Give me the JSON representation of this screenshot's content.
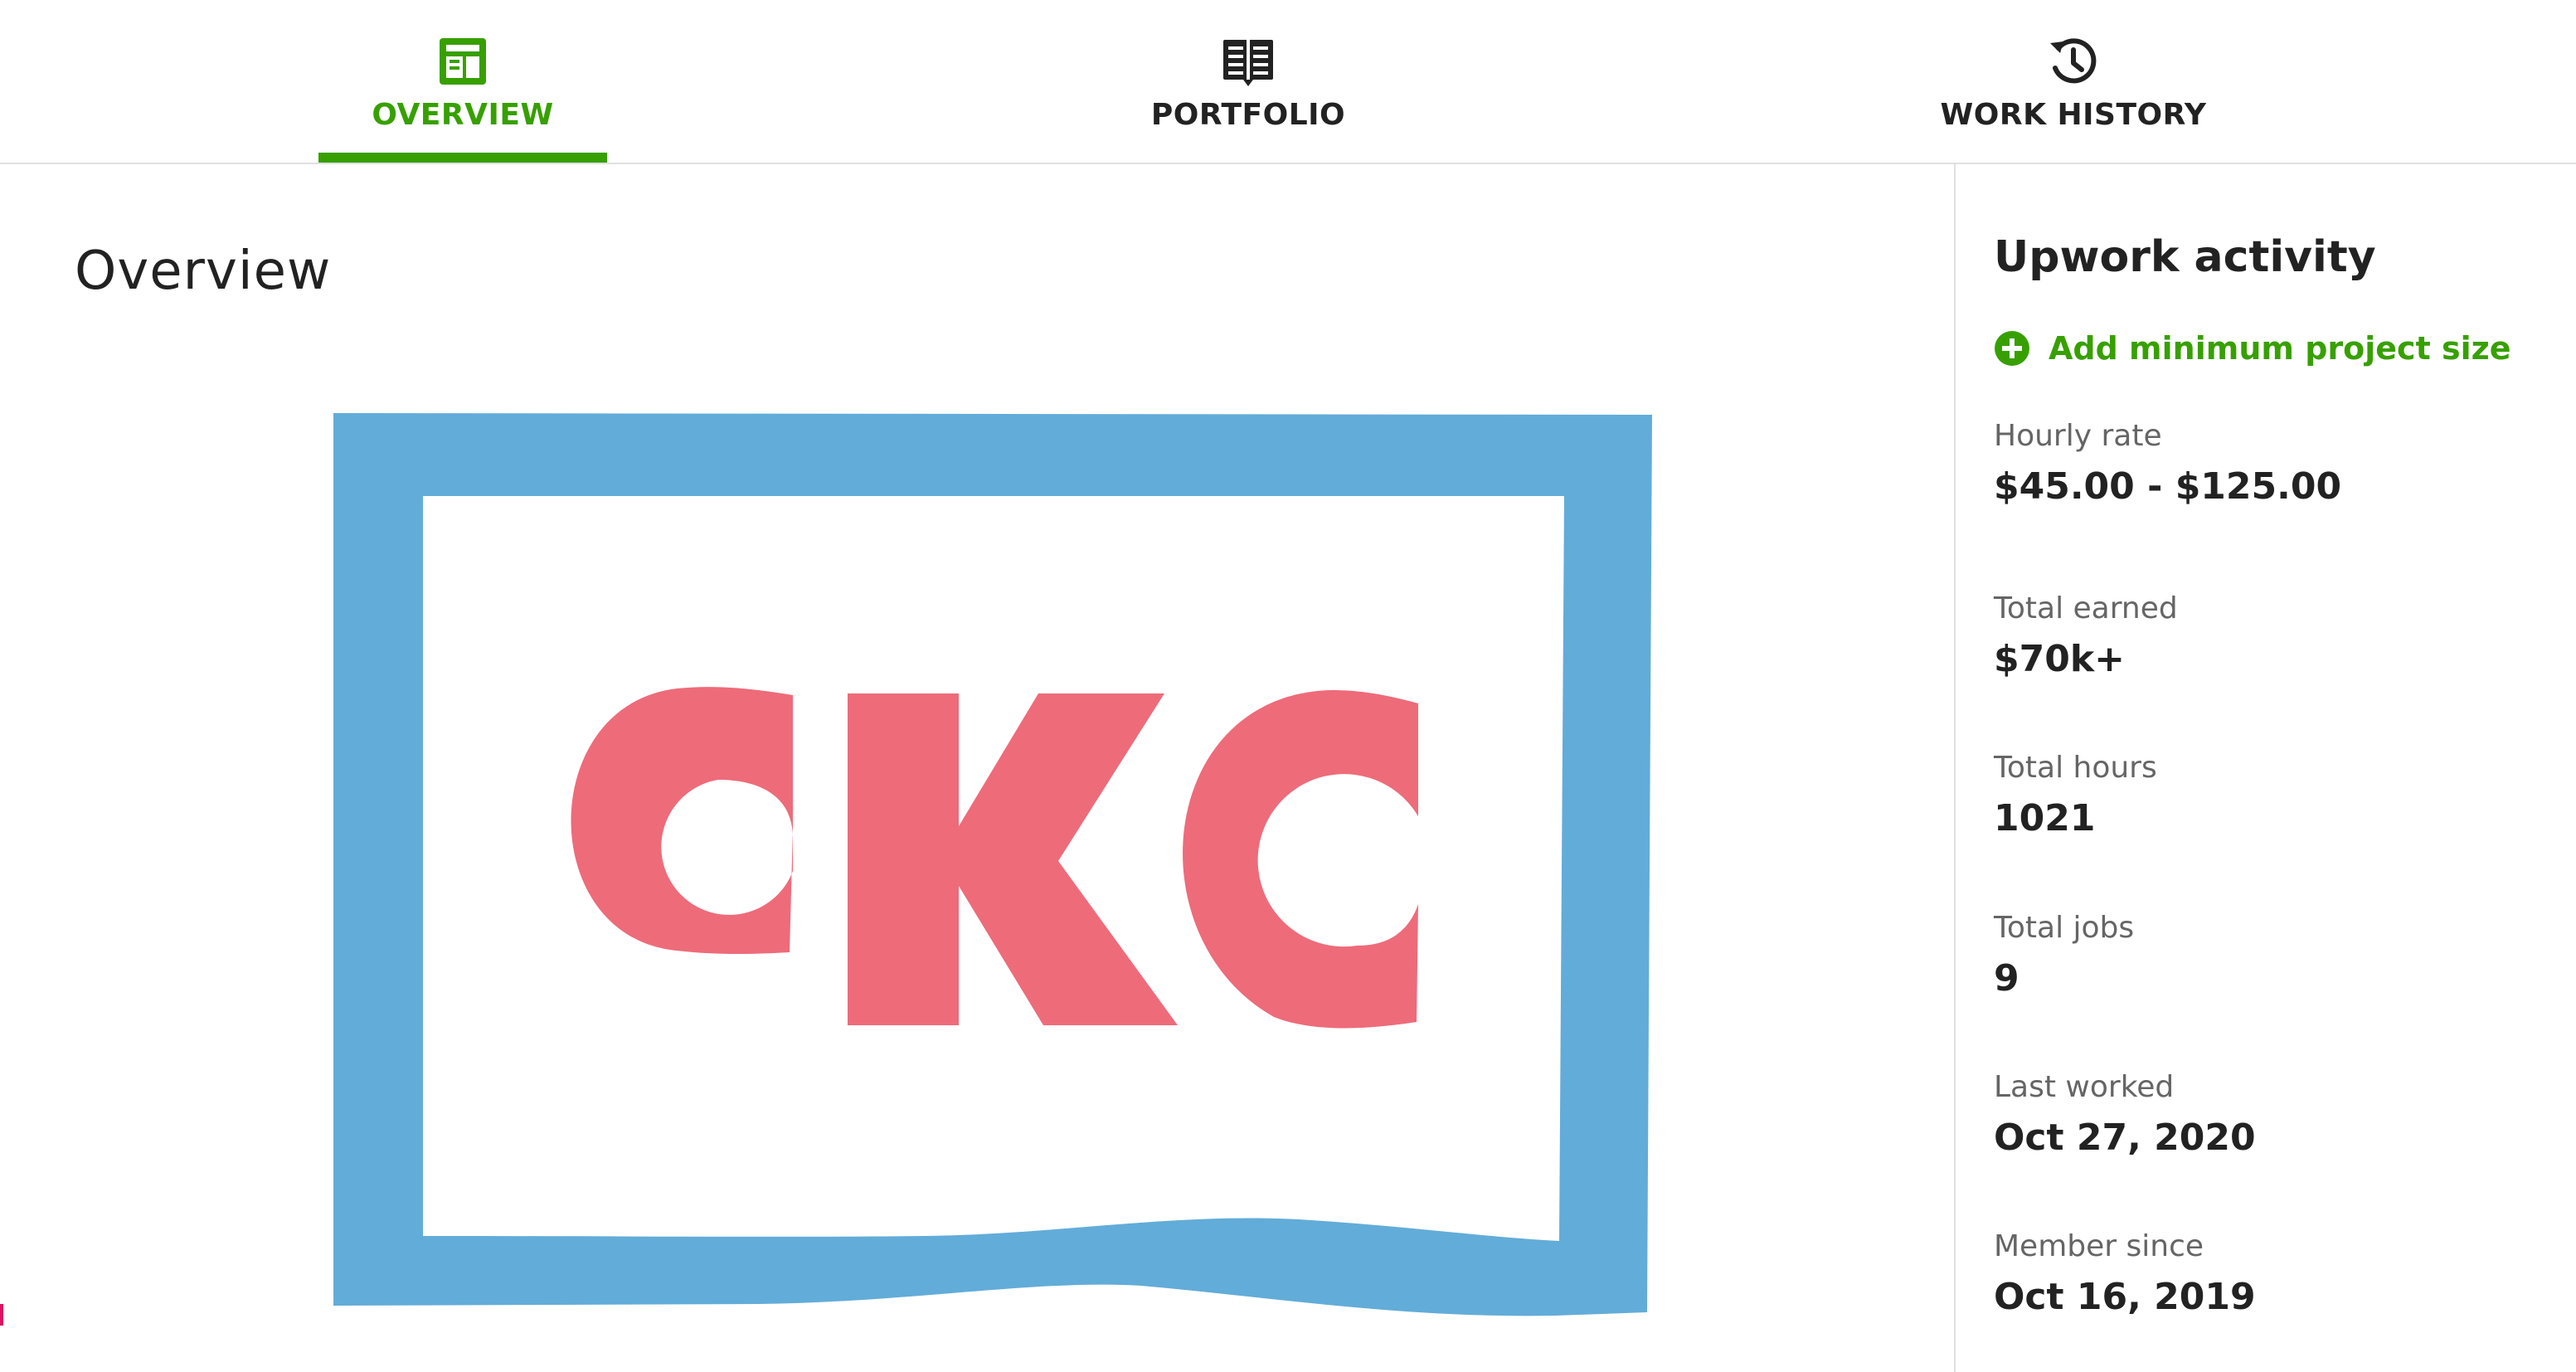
{
  "tabs": [
    {
      "label": "OVERVIEW",
      "icon": "overview-icon",
      "active": true
    },
    {
      "label": "PORTFOLIO",
      "icon": "portfolio-icon",
      "active": false
    },
    {
      "label": "WORK HISTORY",
      "icon": "history-icon",
      "active": false
    }
  ],
  "main": {
    "title": "Overview",
    "image": {
      "logo_text": "CKC",
      "frame_color": "#62acd9",
      "letter_color": "#ee6b7a"
    }
  },
  "sidebar": {
    "title": "Upwork activity",
    "add_link": "Add minimum project size",
    "stats": [
      {
        "label": "Hourly rate",
        "value": "$45.00 - $125.00"
      },
      {
        "label": "Total earned",
        "value": "$70k+"
      },
      {
        "label": "Total hours",
        "value": "1021"
      },
      {
        "label": "Total jobs",
        "value": "9"
      },
      {
        "label": "Last worked",
        "value": "Oct 27, 2020"
      },
      {
        "label": "Member since",
        "value": "Oct 16, 2019"
      }
    ]
  },
  "colors": {
    "accent": "#37a000",
    "text": "#222222",
    "muted": "#656565",
    "divider": "#e0e0e0"
  }
}
